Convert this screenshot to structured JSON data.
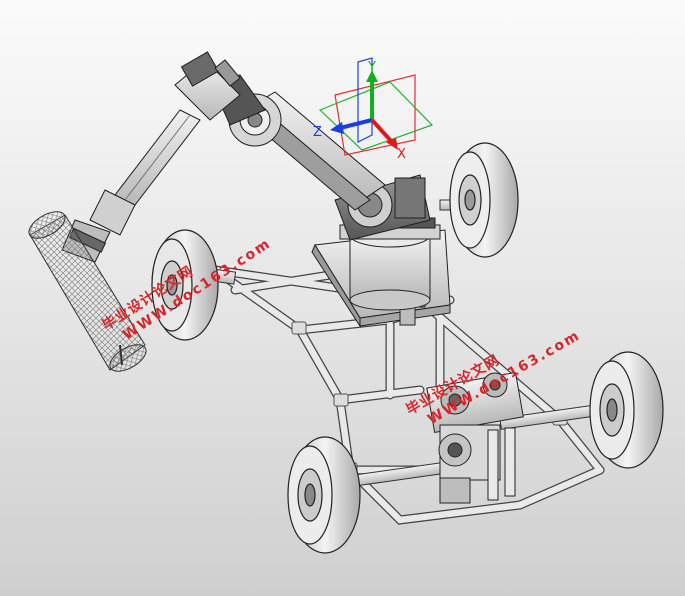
{
  "watermarks": [
    {
      "line1": "毕业设计论文网",
      "line2": "WWW.doc163.com"
    },
    {
      "line1": "毕业设计论文网",
      "line2": "WWW.doc163.com"
    }
  ],
  "triad": {
    "x": "X",
    "y": "Y",
    "z": "Z"
  },
  "colors": {
    "axis_x": "#e01818",
    "axis_y": "#12b01e",
    "axis_z": "#1a3fe0",
    "plane_red": "#e03030",
    "plane_green": "#20b030",
    "plane_blue": "#2040e0",
    "watermark": "#d8252a"
  }
}
